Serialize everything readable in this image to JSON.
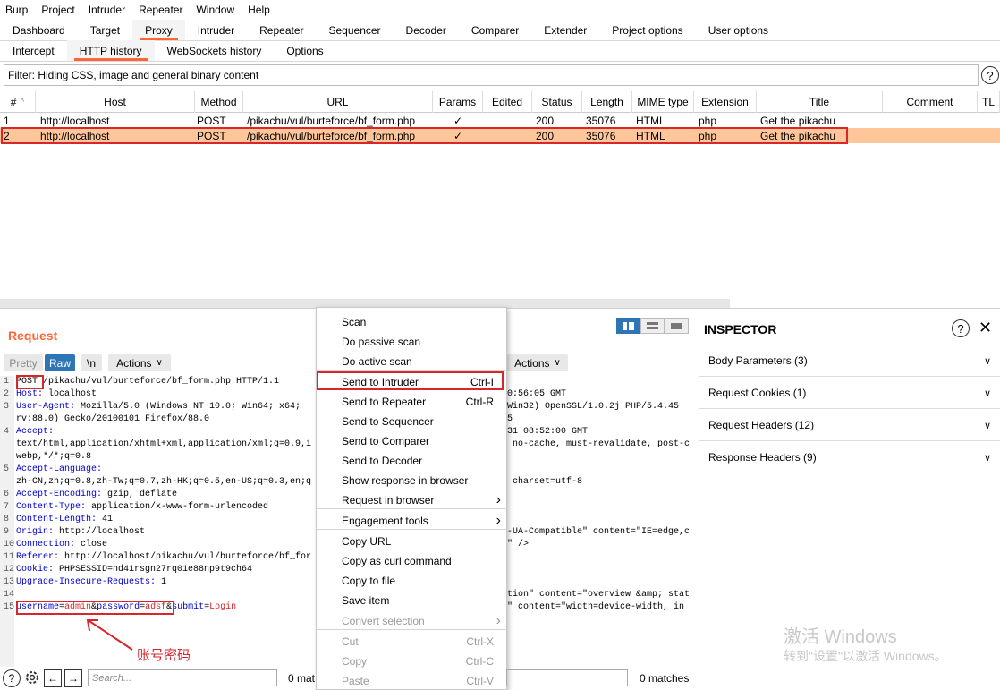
{
  "menubar": [
    "Burp",
    "Project",
    "Intruder",
    "Repeater",
    "Window",
    "Help"
  ],
  "main_tabs": [
    "Dashboard",
    "Target",
    "Proxy",
    "Intruder",
    "Repeater",
    "Sequencer",
    "Decoder",
    "Comparer",
    "Extender",
    "Project options",
    "User options"
  ],
  "main_active": "Proxy",
  "sub_tabs": [
    "Intercept",
    "HTTP history",
    "WebSockets history",
    "Options"
  ],
  "sub_active": "HTTP history",
  "filter_text": "Filter: Hiding CSS, image and general binary content",
  "help_glyph": "?",
  "columns": [
    "#",
    "Host",
    "Method",
    "URL",
    "Params",
    "Edited",
    "Status",
    "Length",
    "MIME type",
    "Extension",
    "Title",
    "Comment",
    "TL"
  ],
  "sort_indicator": "^",
  "rows": [
    {
      "num": "1",
      "host": "http://localhost",
      "method": "POST",
      "url": "/pikachu/vul/burteforce/bf_form.php",
      "params": "✓",
      "status": "200",
      "length": "35076",
      "mime": "HTML",
      "ext": "php",
      "title": "Get the pikachu"
    },
    {
      "num": "2",
      "host": "http://localhost",
      "method": "POST",
      "url": "/pikachu/vul/burteforce/bf_form.php",
      "params": "✓",
      "status": "200",
      "length": "35076",
      "mime": "HTML",
      "ext": "php",
      "title": "Get the pikachu"
    }
  ],
  "request": {
    "title": "Request",
    "pretty": "Pretty",
    "raw": "Raw",
    "newline": "\\n",
    "actions": "Actions",
    "lines": [
      {
        "n": "1",
        "k": "POST",
        "v": " /pikachu/vul/burteforce/bf_form.php HTTP/1.1"
      },
      {
        "n": "2",
        "k": "Host:",
        "v": " localhost"
      },
      {
        "n": "3",
        "k": "User-Agent:",
        "v": " Mozilla/5.0 (Windows NT 10.0; Win64; x64;"
      },
      {
        "n": "",
        "k": "",
        "v": "rv:88.0) Gecko/20100101 Firefox/88.0"
      },
      {
        "n": "4",
        "k": "Accept:",
        "v": ""
      },
      {
        "n": "",
        "k": "",
        "v": "text/html,application/xhtml+xml,application/xml;q=0.9,i"
      },
      {
        "n": "",
        "k": "",
        "v": "webp,*/*;q=0.8"
      },
      {
        "n": "5",
        "k": "Accept-Language:",
        "v": ""
      },
      {
        "n": "",
        "k": "",
        "v": "zh-CN,zh;q=0.8,zh-TW;q=0.7,zh-HK;q=0.5,en-US;q=0.3,en;q"
      },
      {
        "n": "6",
        "k": "Accept-Encoding:",
        "v": " gzip, deflate"
      },
      {
        "n": "7",
        "k": "Content-Type:",
        "v": " application/x-www-form-urlencoded"
      },
      {
        "n": "8",
        "k": "Content-Length:",
        "v": " 41"
      },
      {
        "n": "9",
        "k": "Origin:",
        "v": " http://localhost"
      },
      {
        "n": "10",
        "k": "Connection:",
        "v": " close"
      },
      {
        "n": "11",
        "k": "Referer:",
        "v": " http://localhost/pikachu/vul/burteforce/bf_for"
      },
      {
        "n": "12",
        "k": "Cookie:",
        "v": " PHPSESSID=nd41rsgn27rq01e88np9t9ch64"
      },
      {
        "n": "13",
        "k": "Upgrade-Insecure-Requests:",
        "v": " 1"
      },
      {
        "n": "14",
        "k": "",
        "v": ""
      }
    ],
    "body_line_num": "15",
    "body_k1": "username",
    "body_v1": "admin",
    "body_k2": "password",
    "body_v2": "adsf",
    "body_k3": "submit",
    "body_v3": "Login",
    "eq": "=",
    "amp": "&",
    "annotation": "账号密码"
  },
  "response": {
    "actions": "Actions",
    "lines": [
      {
        "t": "0:56:05 GMT"
      },
      {
        "t": "Win32) OpenSSL/1.0.2j PHP/5.4.45"
      },
      {
        "t": "5"
      },
      {
        "t": "31 08:52:00 GMT"
      },
      {
        "t": " no-cache, must-revalidate, post-c"
      },
      {
        "t": ""
      },
      {
        "t": ""
      },
      {
        "t": " charset=utf-8"
      },
      {
        "t": ""
      },
      {
        "t": ""
      },
      {
        "t": ""
      },
      {
        "t": "-UA-Compatible\" content=\"IE=edge,ch"
      },
      {
        "t": "\" />"
      },
      {
        "t": ""
      },
      {
        "t": ""
      },
      {
        "t": ""
      },
      {
        "t": "tion\" content=\"overview &amp; stat"
      },
      {
        "t": "\" content=\"width=device-width, in"
      }
    ]
  },
  "context_menu": [
    {
      "label": "Scan",
      "shortcut": "",
      "disabled": false,
      "arrow": false
    },
    {
      "label": "Do passive scan",
      "shortcut": "",
      "disabled": false,
      "arrow": false
    },
    {
      "label": "Do active scan",
      "shortcut": "",
      "disabled": false,
      "arrow": false
    },
    {
      "label": "Send to Intruder",
      "shortcut": "Ctrl-I",
      "disabled": false,
      "arrow": false
    },
    {
      "label": "Send to Repeater",
      "shortcut": "Ctrl-R",
      "disabled": false,
      "arrow": false
    },
    {
      "label": "Send to Sequencer",
      "shortcut": "",
      "disabled": false,
      "arrow": false
    },
    {
      "label": "Send to Comparer",
      "shortcut": "",
      "disabled": false,
      "arrow": false
    },
    {
      "label": "Send to Decoder",
      "shortcut": "",
      "disabled": false,
      "arrow": false
    },
    {
      "label": "Show response in browser",
      "shortcut": "",
      "disabled": false,
      "arrow": false
    },
    {
      "label": "Request in browser",
      "shortcut": "",
      "disabled": false,
      "arrow": true
    },
    {
      "label": "Engagement tools",
      "shortcut": "",
      "disabled": false,
      "arrow": true
    },
    {
      "label": "Copy URL",
      "shortcut": "",
      "disabled": false,
      "arrow": false
    },
    {
      "label": "Copy as curl command",
      "shortcut": "",
      "disabled": false,
      "arrow": false
    },
    {
      "label": "Copy to file",
      "shortcut": "",
      "disabled": false,
      "arrow": false
    },
    {
      "label": "Save item",
      "shortcut": "",
      "disabled": false,
      "arrow": false
    },
    {
      "label": "Convert selection",
      "shortcut": "",
      "disabled": true,
      "arrow": true
    },
    {
      "label": "Cut",
      "shortcut": "Ctrl-X",
      "disabled": true,
      "arrow": false
    },
    {
      "label": "Copy",
      "shortcut": "Ctrl-C",
      "disabled": true,
      "arrow": false
    },
    {
      "label": "Paste",
      "shortcut": "Ctrl-V",
      "disabled": true,
      "arrow": false
    }
  ],
  "inspector": {
    "title": "INSPECTOR",
    "close": "✕",
    "sections": [
      "Body Parameters (3)",
      "Request Cookies (1)",
      "Request Headers (12)",
      "Response Headers (9)"
    ]
  },
  "bottom": {
    "search_placeholder": "Search...",
    "matches_left": "0 mat",
    "matches_right": "0 matches"
  },
  "watermark": {
    "line1": "激活 Windows",
    "line2": "转到\"设置\"以激活 Windows。"
  },
  "colors": {
    "accent": "#ff6633",
    "highlight_row": "#ffc69a",
    "annotation_red": "#d9262b",
    "raw_blue": "#2e75b6"
  }
}
